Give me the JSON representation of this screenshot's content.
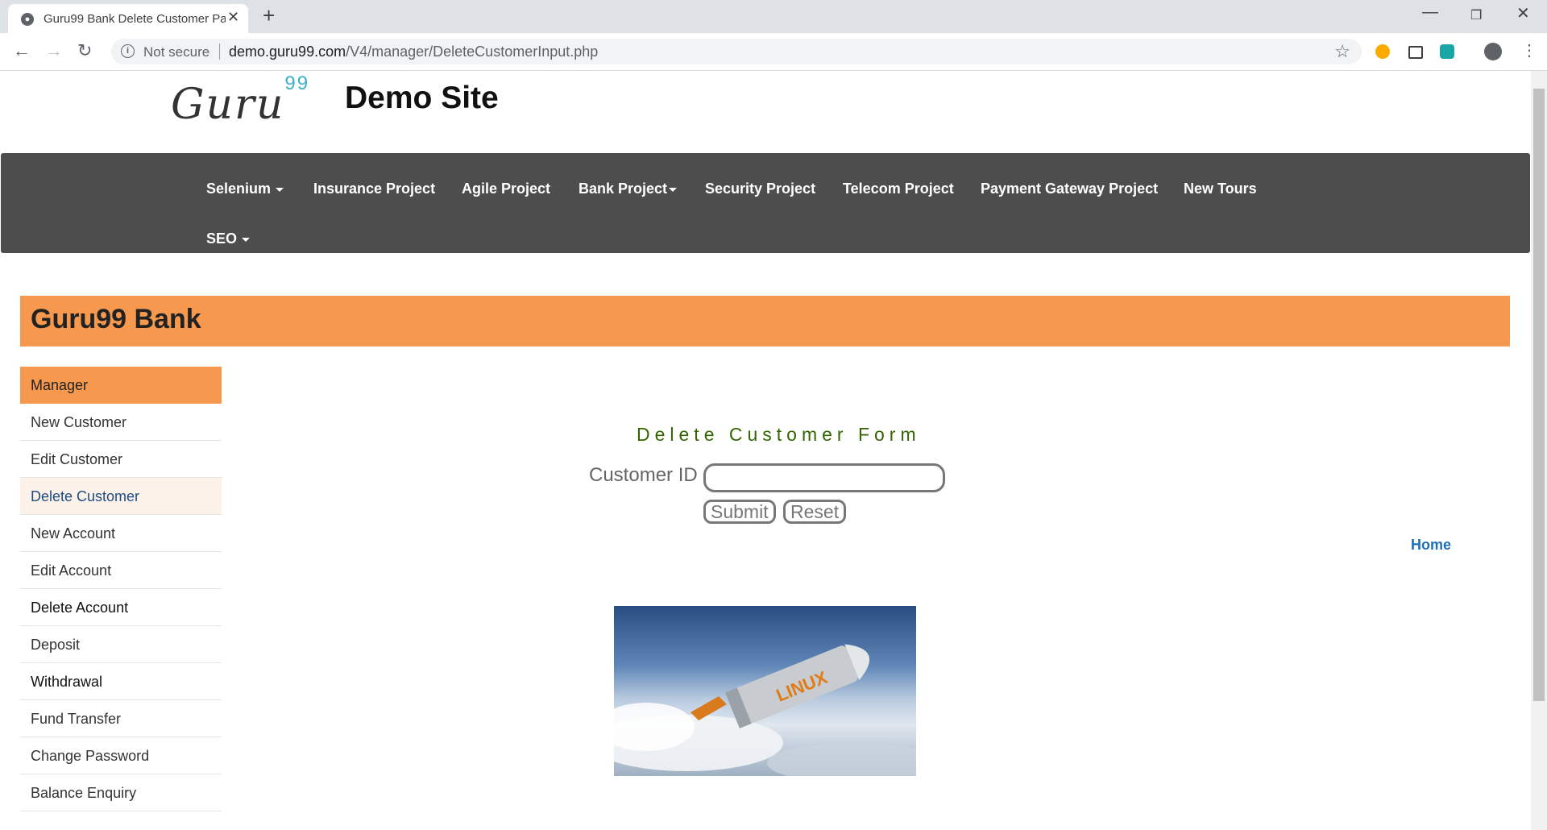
{
  "browser": {
    "tab_title": "Guru99 Bank Delete Customer Pa",
    "security_label": "Not secure",
    "url_host": "demo.guru99.com",
    "url_path": "/V4/manager/DeleteCustomerInput.php"
  },
  "site": {
    "logo_text": "Guru",
    "logo_sup": "99",
    "title": "Demo Site"
  },
  "nav": {
    "row1": [
      "Selenium",
      "Insurance Project",
      "Agile Project",
      "Bank Project",
      "Security Project",
      "Telecom Project",
      "Payment Gateway Project",
      "New Tours"
    ],
    "row2": [
      "SEO"
    ]
  },
  "bank": {
    "title": "Guru99 Bank"
  },
  "sidebar": {
    "items": [
      "Manager",
      "New Customer",
      "Edit Customer",
      "Delete Customer",
      "New Account",
      "Edit Account",
      "Delete Account",
      "Deposit",
      "Withdrawal",
      "Fund Transfer",
      "Change Password",
      "Balance Enquiry"
    ]
  },
  "form": {
    "title": "Delete Customer Form",
    "customer_id_label": "Customer ID",
    "customer_id_value": "",
    "submit_label": "Submit",
    "reset_label": "Reset"
  },
  "links": {
    "home": "Home"
  },
  "banner": {
    "text": "LINUX"
  },
  "colors": {
    "nav_bg": "#4d4d4d",
    "accent_orange": "#f6994e",
    "form_title_green": "#336600",
    "link_blue": "#1f6fb5"
  }
}
